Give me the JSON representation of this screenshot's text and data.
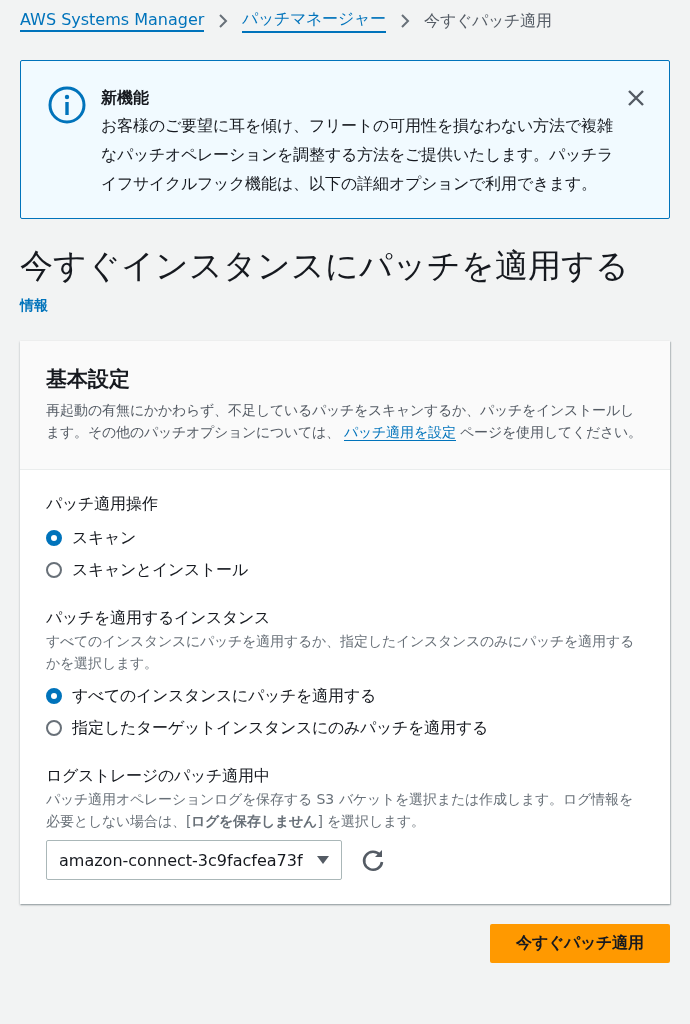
{
  "breadcrumb": {
    "links": [
      "AWS Systems Manager",
      "パッチマネージャー"
    ],
    "current": "今すぐパッチ適用"
  },
  "alert": {
    "title": "新機能",
    "body": "お客様のご要望に耳を傾け、フリートの可用性を損なわない方法で複雑なパッチオペレーションを調整する方法をご提供いたします。パッチライフサイクルフック機能は、以下の詳細オプションで利用できます。"
  },
  "page_title": "今すぐインスタンスにパッチを適用する",
  "info_link": "情報",
  "card": {
    "title": "基本設定",
    "description_before": "再起動の有無にかかわらず、不足しているパッチをスキャンするか、パッチをインストールします。その他のパッチオプションについては、",
    "description_link": "パッチ適用を設定",
    "description_after": "ページを使用してください。"
  },
  "operation": {
    "label": "パッチ適用操作",
    "options": [
      {
        "label": "スキャン",
        "selected": true
      },
      {
        "label": "スキャンとインストール",
        "selected": false
      }
    ]
  },
  "instances": {
    "label": "パッチを適用するインスタンス",
    "description": "すべてのインスタンスにパッチを適用するか、指定したインスタンスのみにパッチを適用するかを選択します。",
    "options": [
      {
        "label": "すべてのインスタンスにパッチを適用する",
        "selected": true
      },
      {
        "label": "指定したターゲットインスタンスにのみパッチを適用する",
        "selected": false
      }
    ]
  },
  "log_storage": {
    "label": "ログストレージのパッチ適用中",
    "description": "パッチ適用オペレーションログを保存する S3 バケットを選択または作成します。ログ情報を必要としない場合は、[**ログを保存しません**] を選択します。",
    "value": "amazon-connect-3c9facfea73f"
  },
  "submit": "今すぐパッチ適用"
}
